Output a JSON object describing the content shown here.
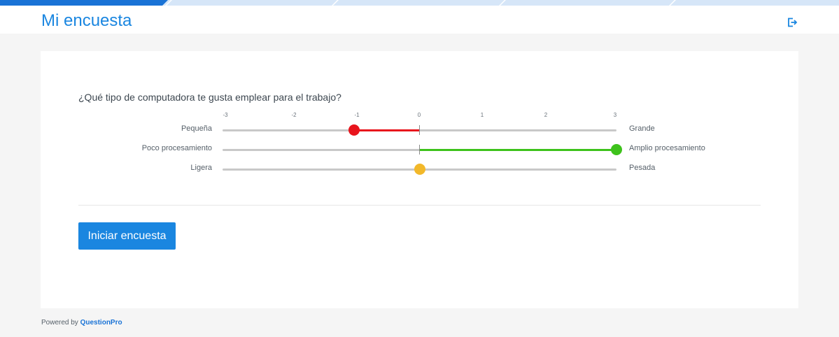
{
  "header": {
    "title": "Mi encuesta",
    "icon": "logout-icon"
  },
  "question": {
    "text": "¿Qué tipo de computadora te gusta emplear para el trabajo?",
    "scale_ticks": [
      "-3",
      "-2",
      "-1",
      "0",
      "1",
      "2",
      "3"
    ],
    "scale_min": -3,
    "scale_max": 3,
    "rows": [
      {
        "left_label": "Pequeña",
        "right_label": "Grande",
        "value": -1,
        "color": "#e8141c"
      },
      {
        "left_label": "Poco procesamiento",
        "right_label": "Amplio procesamiento",
        "value": 3,
        "color": "#3ec21c"
      },
      {
        "left_label": "Ligera",
        "right_label": "Pesada",
        "value": 0,
        "color": "#f2b82a"
      }
    ]
  },
  "actions": {
    "start_label": "Iniciar encuesta"
  },
  "footer": {
    "prefix": "Powered by ",
    "brand": "QuestionPro"
  },
  "colors": {
    "accent": "#1a86e0",
    "brand": "#1a73d6",
    "track": "#c8c8c8"
  }
}
